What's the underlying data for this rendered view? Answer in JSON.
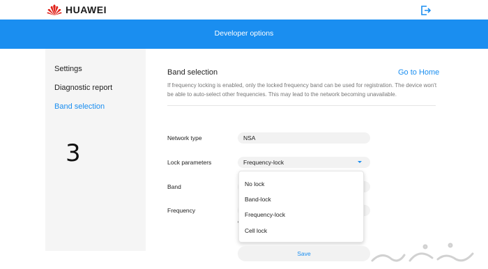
{
  "header": {
    "brand": "HUAWEI",
    "banner_title": "Developer options"
  },
  "sidebar": {
    "items": [
      {
        "label": "Settings",
        "active": false
      },
      {
        "label": "Diagnostic report",
        "active": false
      },
      {
        "label": "Band selection",
        "active": true
      }
    ],
    "annotation": "3"
  },
  "main": {
    "title": "Band selection",
    "go_home": "Go to Home",
    "warning": "If frequency locking is enabled, only the locked frequency band can be used for registration. The device won't be able to auto-select other frequencies. This may lead to the network becoming unavailable.",
    "form": {
      "network_type": {
        "label": "Network type",
        "value": "NSA"
      },
      "lock_parameters": {
        "label": "Lock parameters",
        "value": "Frequency-lock",
        "options": [
          "No lock",
          "Band-lock",
          "Frequency-lock",
          "Cell lock"
        ]
      },
      "band": {
        "label": "Band"
      },
      "frequency": {
        "label": "Frequency"
      }
    },
    "save_label": "Save"
  },
  "colors": {
    "accent": "#1a8ef0",
    "brand_red": "#e0231b",
    "sidebar_bg": "#f5f5f5"
  },
  "icons": {
    "logo": "huawei-logo",
    "logout": "logout-icon",
    "caret": "caret-down-icon"
  }
}
